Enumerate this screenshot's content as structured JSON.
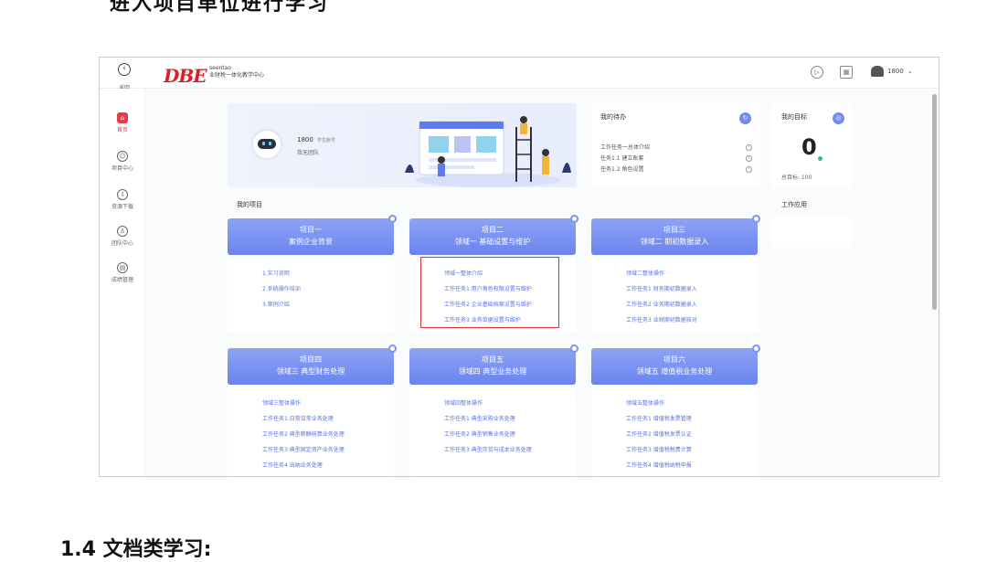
{
  "document": {
    "top_heading": "进入项目单位进行学习",
    "bottom_heading": "1.4 文档类学习:"
  },
  "topbar": {
    "back_label": "返回",
    "logo_text": "DBE",
    "logo_sub_line1": "seentao",
    "logo_sub_line2": "业财税一体化教学中心",
    "user_name": "1800",
    "play_icon": "play-circle-icon",
    "calendar_icon": "calendar-icon",
    "chevron": "⌄"
  },
  "sidebar": {
    "items": [
      {
        "label": "首页",
        "icon": "home-icon",
        "glyph": "⌂"
      },
      {
        "label": "项目中心",
        "icon": "smile-icon",
        "glyph": "☺"
      },
      {
        "label": "资源下载",
        "icon": "download-icon",
        "glyph": "⇩"
      },
      {
        "label": "团队中心",
        "icon": "team-icon",
        "glyph": "♙"
      },
      {
        "label": "成绩管理",
        "icon": "report-icon",
        "glyph": "▤"
      }
    ]
  },
  "banner": {
    "user": "1800",
    "user_note": "学生账号",
    "team": "我无团队"
  },
  "todo": {
    "title": "我的待办",
    "items": [
      "工作任务一总体介绍",
      "任务1.1 建立账套",
      "任务1.2 角色设置"
    ]
  },
  "goal": {
    "title": "我的目标",
    "value": "0",
    "target_label": "总目标: 100"
  },
  "apps_title": "工作应用",
  "projects_title": "我的项目",
  "projects": [
    {
      "line1": "项目一",
      "line2": "案例企业背景",
      "items": [
        "1.实习说明",
        "2.系统操作培训",
        "3.案例介绍"
      ]
    },
    {
      "line1": "项目二",
      "line2": "领域一 基础设置与维护",
      "items": [
        "领域一整体介绍",
        "工作任务1 用户角色权限设置与维护",
        "工作任务2 企业基础档案设置与维护",
        "工作任务3 业务单据设置与维护"
      ]
    },
    {
      "line1": "项目三",
      "line2": "领域二 期初数据录入",
      "items": [
        "领域二整体操作",
        "工作任务1 财务期初数据录入",
        "工作任务2 业务期初数据录入",
        "工作任务3 业财期初数据核对"
      ]
    },
    {
      "line1": "项目四",
      "line2": "领域三 典型财务处理",
      "items": [
        "领域三整体操作",
        "工作任务1 日常日常业务处理",
        "工作任务2 典型薪酬核算业务处理",
        "工作任务3 典型固定资产业务处理",
        "工作任务4 出纳业务处理"
      ]
    },
    {
      "line1": "项目五",
      "line2": "领域四 典型业务处理",
      "items": [
        "领域四整体操作",
        "工作任务1 典型采购业务处理",
        "工作任务2 典型销售业务处理",
        "工作任务3 典型存货与成本业务处理"
      ]
    },
    {
      "line1": "项目六",
      "line2": "领域五 增值税业务处理",
      "items": [
        "领域五整体操作",
        "工作任务1 增值税发票管理",
        "工作任务2 增值税发票认证",
        "工作任务3 增值税税费计算",
        "工作任务4 增值税纳税申报"
      ]
    }
  ]
}
